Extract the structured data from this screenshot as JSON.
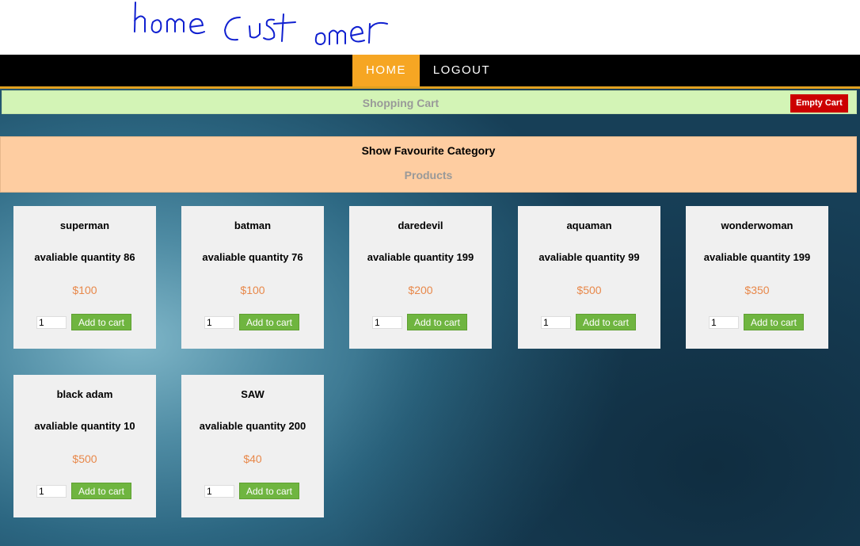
{
  "header": {
    "handwritten_title": "home Customer"
  },
  "nav": {
    "home": "HOME",
    "logout": "LOGOUT"
  },
  "cart": {
    "title": "Shopping Cart",
    "empty_label": "Empty Cart"
  },
  "category": {
    "show_favourite": "Show Favourite Category",
    "products_title": "Products"
  },
  "products": [
    {
      "name": "superman",
      "qty_text": "avaliable quantity 86",
      "price": "$100",
      "input_value": "1",
      "button": "Add to cart"
    },
    {
      "name": "batman",
      "qty_text": "avaliable quantity 76",
      "price": "$100",
      "input_value": "1",
      "button": "Add to cart"
    },
    {
      "name": "daredevil",
      "qty_text": "avaliable quantity 199",
      "price": "$200",
      "input_value": "1",
      "button": "Add to cart"
    },
    {
      "name": "aquaman",
      "qty_text": "avaliable quantity 99",
      "price": "$500",
      "input_value": "1",
      "button": "Add to cart"
    },
    {
      "name": "wonderwoman",
      "qty_text": "avaliable quantity 199",
      "price": "$350",
      "input_value": "1",
      "button": "Add to cart"
    },
    {
      "name": "black adam",
      "qty_text": "avaliable quantity 10",
      "price": "$500",
      "input_value": "1",
      "button": "Add to cart"
    },
    {
      "name": "SAW",
      "qty_text": "avaliable quantity 200",
      "price": "$40",
      "input_value": "1",
      "button": "Add to cart"
    }
  ],
  "colors": {
    "nav_active": "#f6a623",
    "cart_bar": "#d3f4b6",
    "category_panel": "#fecda1",
    "price": "#e8884a",
    "add_button": "#6fb540",
    "empty_cart": "#cc0000"
  }
}
